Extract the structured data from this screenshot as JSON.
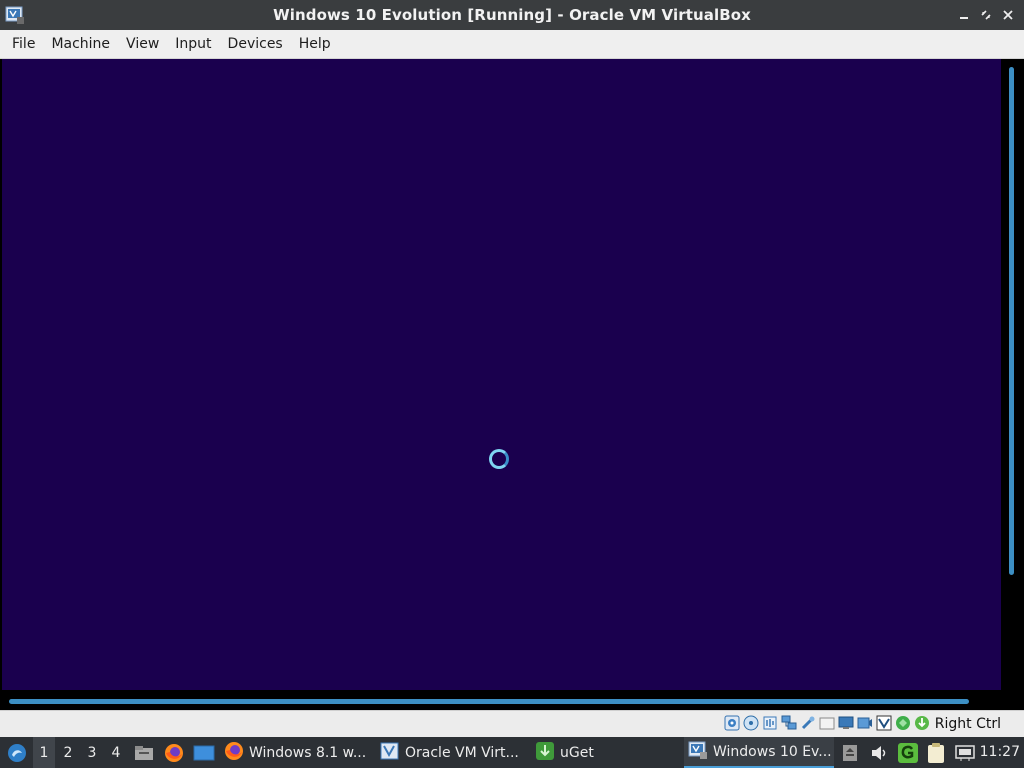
{
  "window": {
    "title": "Windows 10 Evolution [Running] - Oracle VM VirtualBox",
    "app_icon": "virtualbox-icon",
    "controls": [
      "minimize-icon",
      "restore-icon",
      "close-icon"
    ]
  },
  "menubar": {
    "items": [
      {
        "label": "File"
      },
      {
        "label": "Machine"
      },
      {
        "label": "View"
      },
      {
        "label": "Input"
      },
      {
        "label": "Devices"
      },
      {
        "label": "Help"
      }
    ]
  },
  "vm_display": {
    "background_color": "#1a004e",
    "state": "loading-spinner"
  },
  "statusbar": {
    "icons": [
      "hard-disk-icon",
      "optical-drive-icon",
      "audio-icon",
      "network-icon",
      "usb-icon",
      "shared-folders-icon",
      "display-icon",
      "video-capture-icon",
      "virtualization-icon",
      "cpu-icon",
      "mouse-integration-icon"
    ],
    "host_key": "Right Ctrl"
  },
  "taskbar": {
    "launcher_icon": "lxqt-menu-icon",
    "workspaces": [
      "1",
      "2",
      "3",
      "4"
    ],
    "active_workspace": "1",
    "quicklaunch": [
      "file-manager-icon",
      "firefox-icon",
      "show-desktop-icon"
    ],
    "tasks": [
      {
        "label": "Windows 8.1 w...",
        "icon": "firefox-icon"
      },
      {
        "label": "Oracle VM Virt...",
        "icon": "virtualbox-icon"
      },
      {
        "label": "uGet",
        "icon": "uget-icon"
      },
      {
        "label": "Windows 10 Ev...",
        "icon": "virtualbox-icon",
        "active": true
      }
    ],
    "tray": [
      "removable-drive-icon",
      "volume-icon",
      "uget-tray-icon",
      "clipboard-icon",
      "network-tray-icon"
    ],
    "clock": "11:27"
  }
}
